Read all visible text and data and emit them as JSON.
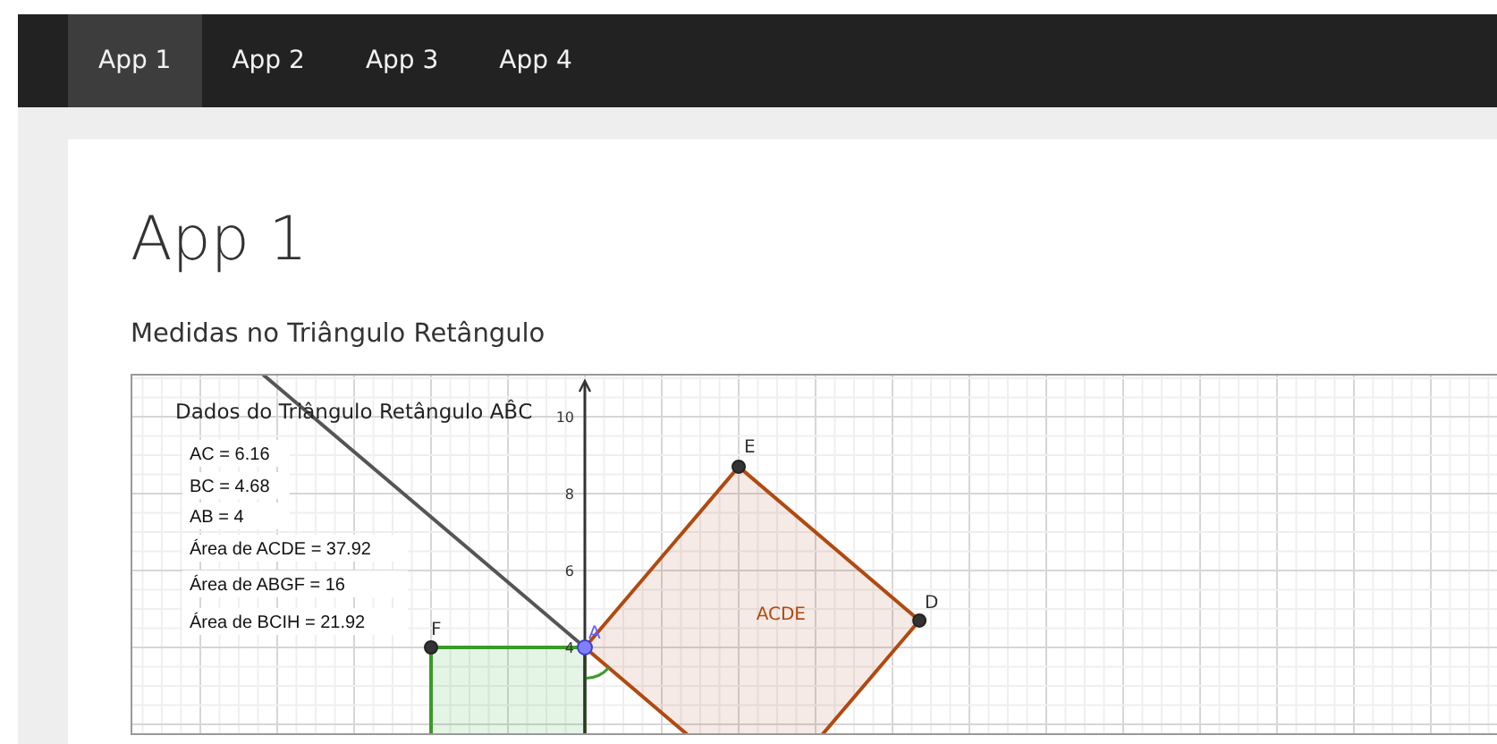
{
  "nav": {
    "items": [
      {
        "label": "App 1",
        "selected": true
      },
      {
        "label": "App 2",
        "selected": false
      },
      {
        "label": "App 3",
        "selected": false
      },
      {
        "label": "App 4",
        "selected": false
      }
    ]
  },
  "page": {
    "title": "App 1",
    "subtitle": "Medidas no Triângulo Retângulo"
  },
  "applet": {
    "title": "Dados do Triângulo Retângulo AB̂C",
    "measures": [
      "AC = 6.16",
      "BC = 4.68",
      "AB = 4",
      "Área de ACDE = 37.92",
      "Área de ABGF = 16",
      "Área de BCIH = 21.92"
    ],
    "axis_labels": [
      "10",
      "8",
      "6",
      "4"
    ],
    "points": [
      {
        "label": "A",
        "kind": "free"
      },
      {
        "label": "E",
        "kind": "dependent"
      },
      {
        "label": "D",
        "kind": "dependent"
      },
      {
        "label": "F",
        "kind": "dependent"
      }
    ],
    "polygon_label": "ACDE"
  }
}
